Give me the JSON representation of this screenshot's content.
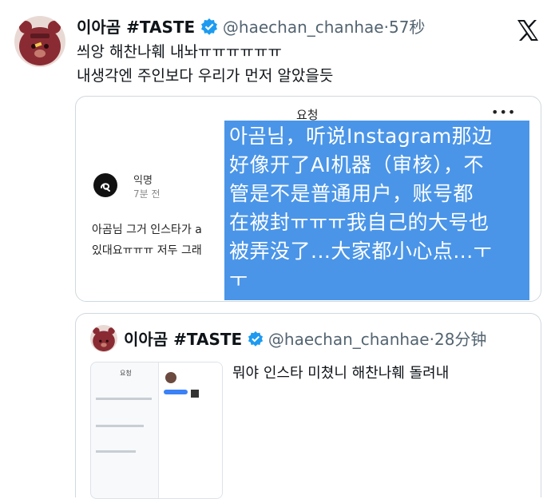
{
  "tweet": {
    "display_name": "이아곰 #TASTE",
    "handle": "@haechan_chanhae",
    "time": "·57秒",
    "line1": "씌앙 해찬나훼 내놔ㅠㅠㅠㅠㅠㅠ",
    "line2": "내생각엔 주인보다 우리가 먼저 알았을듯"
  },
  "request_card": {
    "title": "요청",
    "more": "•••",
    "anon_name": "익명",
    "anon_time": "7분 전",
    "msg_line1": "아곰님 그거 인스타가 a",
    "msg_line2": "있대요ㅠㅠㅠ 저두 그래"
  },
  "overlay_text": [
    "아곰님，听说Instagram那边",
    "好像开了AI机器（审核），不",
    "管是不是普通用户，账号都",
    "在被封ㅠㅠㅠ我自己的大号也",
    "被弄没了...大家都小心点...ㅜ",
    "ㅜ"
  ],
  "quoted": {
    "display_name": "이아곰 #TASTE",
    "handle": "@haechan_chanhae",
    "time": "·28分钟",
    "text": "뭐야 인스타 미쳤니 해찬나훼 돌려내",
    "thumb_title": "요청"
  },
  "colors": {
    "verified": "#1d9bf0",
    "overlay": "#4a95e8",
    "avatar": "#8a2b33"
  }
}
